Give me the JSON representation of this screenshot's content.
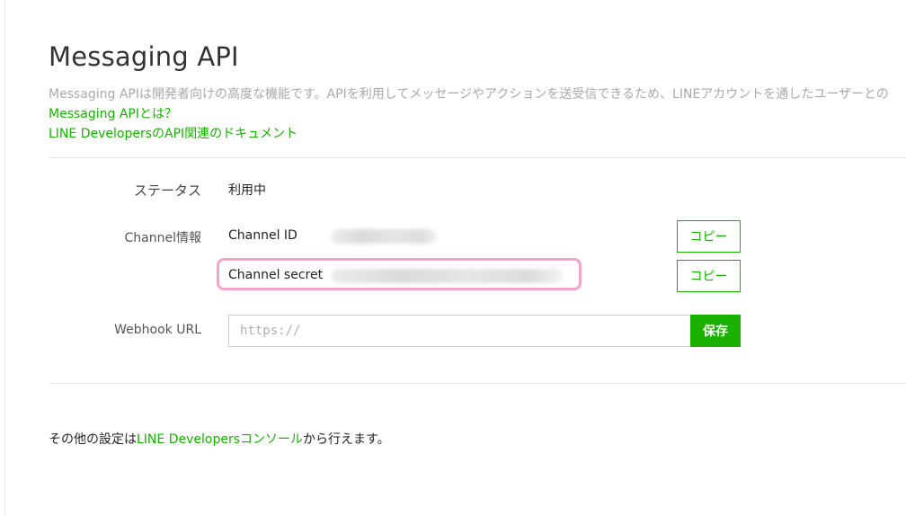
{
  "page": {
    "title": "Messaging API",
    "description": "Messaging APIは開発者向けの高度な機能です。APIを利用してメッセージやアクションを送受信できるため、LINEアカウントを通したユーザーとの",
    "link_what": "Messaging APIとは？",
    "link_docs": "LINE DevelopersのAPI関連のドキュメント"
  },
  "status": {
    "label": "ステータス",
    "value": "利用中"
  },
  "channel": {
    "label": "Channel情報",
    "id_key": "Channel ID",
    "secret_key": "Channel secret",
    "copy_label": "コピー"
  },
  "webhook": {
    "label": "Webhook URL",
    "placeholder": "https://",
    "save_label": "保存"
  },
  "footer": {
    "prefix": "その他の設定は",
    "link": "LINE Developersコンソール",
    "suffix": "から行えます。"
  },
  "colors": {
    "accent": "#1ab000",
    "highlight": "#f5a3c8"
  }
}
